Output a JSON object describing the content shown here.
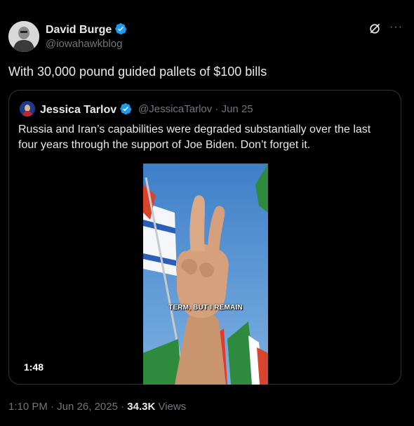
{
  "author": {
    "name": "David Burge",
    "handle": "@iowahawkblog"
  },
  "tweet": {
    "text": "With 30,000 pound guided pallets of $100 bills"
  },
  "quoted": {
    "name": "Jessica Tarlov",
    "handle_date": "@JessicaTarlov · Jun 25",
    "text": "Russia and Iran’s capabilities were degraded substantially over the last four years through the support of Joe Biden. Don’t forget it.",
    "video_caption": "TERM, BUT I REMAIN",
    "video_duration": "1:48"
  },
  "meta": {
    "time_date": "1:10 PM · Jun 26, 2025 · ",
    "views_count": "34.3K",
    "views_label": " Views"
  },
  "icons": [
    "verified-badge-icon",
    "grok-icon",
    "more-icon"
  ],
  "colors": {
    "verified": "#1d9bf0",
    "muted": "#71767b",
    "border": "#2f3336"
  }
}
